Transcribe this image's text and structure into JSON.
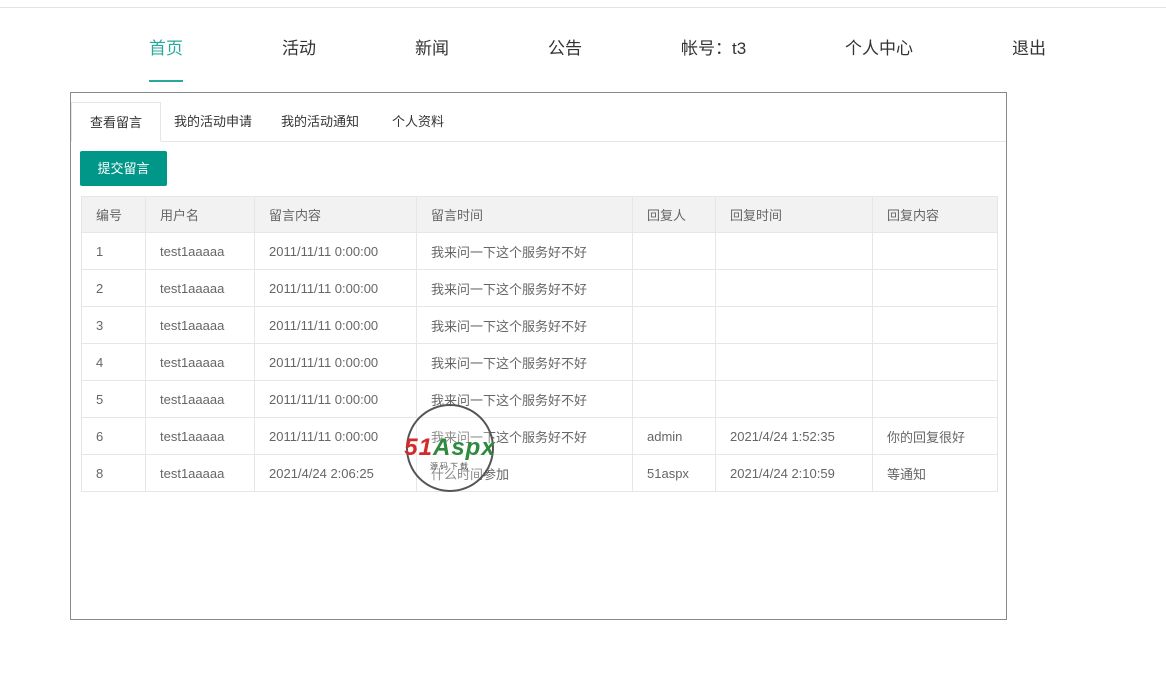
{
  "nav": {
    "items": [
      {
        "label": "首页",
        "active": true
      },
      {
        "label": "活动",
        "active": false
      },
      {
        "label": "新闻",
        "active": false
      },
      {
        "label": "公告",
        "active": false
      },
      {
        "label": "帐号：t3",
        "active": false
      },
      {
        "label": "个人中心",
        "active": false
      },
      {
        "label": "退出",
        "active": false
      }
    ]
  },
  "tabs": [
    {
      "label": "查看留言",
      "active": true
    },
    {
      "label": "我的活动申请",
      "active": false
    },
    {
      "label": "我的活动通知",
      "active": false
    },
    {
      "label": "个人资料",
      "active": false
    }
  ],
  "actions": {
    "submit_label": "提交留言"
  },
  "table": {
    "headers": [
      "编号",
      "用户名",
      "留言内容",
      "留言时间",
      "回复人",
      "回复时间",
      "回复内容"
    ],
    "rows": [
      [
        "1",
        "test1aaaaa",
        "2011/11/11 0:00:00",
        "我来问一下这个服务好不好",
        "",
        "",
        ""
      ],
      [
        "2",
        "test1aaaaa",
        "2011/11/11 0:00:00",
        "我来问一下这个服务好不好",
        "",
        "",
        ""
      ],
      [
        "3",
        "test1aaaaa",
        "2011/11/11 0:00:00",
        "我来问一下这个服务好不好",
        "",
        "",
        ""
      ],
      [
        "4",
        "test1aaaaa",
        "2011/11/11 0:00:00",
        "我来问一下这个服务好不好",
        "",
        "",
        ""
      ],
      [
        "5",
        "test1aaaaa",
        "2011/11/11 0:00:00",
        "我来问一下这个服务好不好",
        "",
        "",
        ""
      ],
      [
        "6",
        "test1aaaaa",
        "2011/11/11 0:00:00",
        "我来问一下这个服务好不好",
        "admin",
        "2021/4/24 1:52:35",
        "你的回复很好"
      ],
      [
        "8",
        "test1aaaaa",
        "2021/4/24 2:06:25",
        "什么时间参加",
        "51aspx",
        "2021/4/24 2:10:59",
        "等通知"
      ]
    ]
  },
  "watermark": {
    "logo_a": "51",
    "logo_b": "Aspx",
    "sub": "源码下载"
  },
  "colors": {
    "accent": "#2aa99a",
    "button": "#009688"
  }
}
